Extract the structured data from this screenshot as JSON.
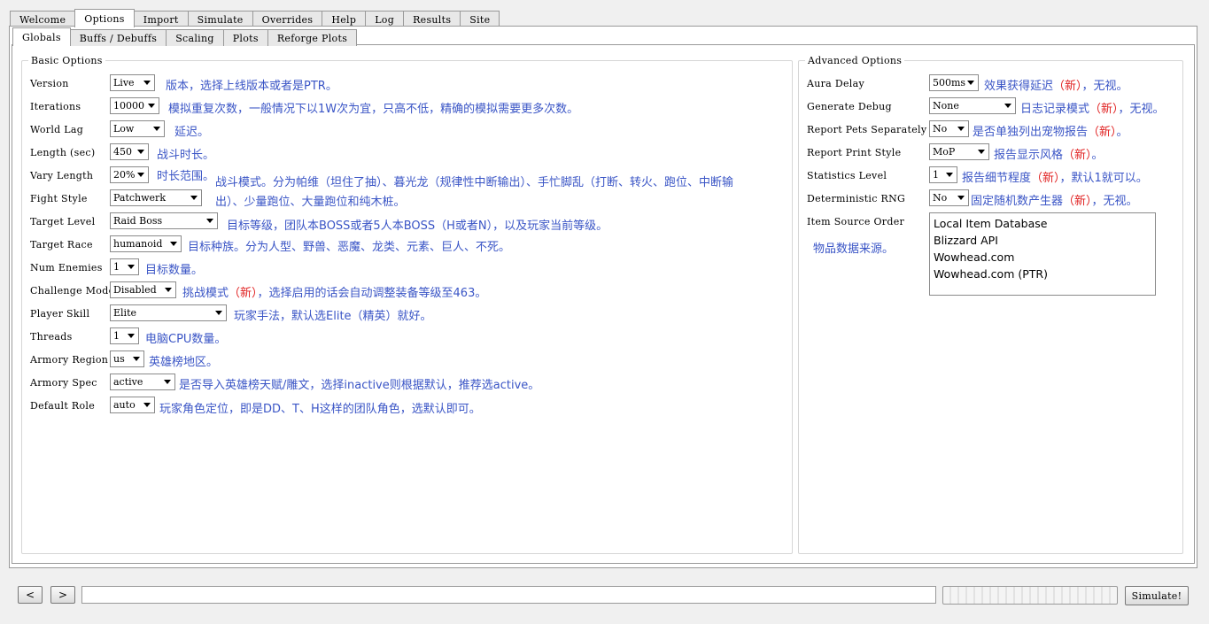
{
  "main_tabs": [
    "Welcome",
    "Options",
    "Import",
    "Simulate",
    "Overrides",
    "Help",
    "Log",
    "Results",
    "Site"
  ],
  "sub_tabs": [
    "Globals",
    "Buffs / Debuffs",
    "Scaling",
    "Plots",
    "Reforge Plots"
  ],
  "basic": {
    "title": "Basic Options",
    "rows": [
      {
        "label": "Version",
        "value": "Live",
        "note": "版本，选择上线版本或者是PTR。"
      },
      {
        "label": "Iterations",
        "value": "10000",
        "note": "模拟重复次数，一般情况下以1W次为宜，只高不低，精确的模拟需要更多次数。"
      },
      {
        "label": "World Lag",
        "value": "Low",
        "note": "延迟。"
      },
      {
        "label": "Length (sec)",
        "value": "450",
        "note": "战斗时长。"
      },
      {
        "label": "Vary Length",
        "value": "20%",
        "note": "时长范围。"
      },
      {
        "label": "Fight Style",
        "value": "Patchwerk",
        "note": "战斗模式。分为帕维（坦住了抽）、暮光龙（规律性中断输出）、手忙脚乱（打断、转火、跑位、中断输出）、少量跑位、大量跑位和纯木桩。"
      },
      {
        "label": "Target Level",
        "value": "Raid Boss",
        "note": "目标等级，团队本BOSS或者5人本BOSS（H或者N），以及玩家当前等级。"
      },
      {
        "label": "Target Race",
        "value": "humanoid",
        "note": "目标种族。分为人型、野兽、恶魔、龙类、元素、巨人、不死。"
      },
      {
        "label": "Num Enemies",
        "value": "1",
        "note": "目标数量。"
      },
      {
        "label": "Challenge Mode",
        "value": "Disabled",
        "note_pre": "挑战模式",
        "note_new": "（新）",
        "note_post": "，选择启用的话会自动调整装备等级至463。"
      },
      {
        "label": "Player Skill",
        "value": "Elite",
        "note": "玩家手法，默认选Elite（精英）就好。"
      },
      {
        "label": "Threads",
        "value": "1",
        "note": "电脑CPU数量。"
      },
      {
        "label": "Armory Region",
        "value": "us",
        "note": "英雄榜地区。"
      },
      {
        "label": "Armory Spec",
        "value": "active",
        "note": "是否导入英雄榜天赋/雕文，选择inactive则根据默认，推荐选active。"
      },
      {
        "label": "Default Role",
        "value": "auto",
        "note": "玩家角色定位，即是DD、T、H这样的团队角色，选默认即可。"
      }
    ]
  },
  "advanced": {
    "title": "Advanced Options",
    "rows": [
      {
        "label": "Aura Delay",
        "value": "500ms",
        "note_pre": "效果获得延迟",
        "note_new": "（新）",
        "note_post": "，无视。"
      },
      {
        "label": "Generate Debug",
        "value": "None",
        "note_pre": "日志记录模式",
        "note_new": "（新）",
        "note_post": "，无视。"
      },
      {
        "label": "Report Pets Separately",
        "value": "No",
        "note_pre": "是否单独列出宠物报告",
        "note_new": "（新）",
        "note_post": "。"
      },
      {
        "label": "Report Print Style",
        "value": "MoP",
        "note_pre": "报告显示风格",
        "note_new": "（新）",
        "note_post": "。"
      },
      {
        "label": "Statistics Level",
        "value": "1",
        "note_pre": "报告细节程度",
        "note_new": "（新）",
        "note_post": "，默认1就可以。"
      },
      {
        "label": "Deterministic RNG",
        "value": "No",
        "note_pre": "固定随机数产生器",
        "note_new": "（新）",
        "note_post": "，无视。"
      }
    ],
    "item_source_label": "Item Source Order",
    "item_source_note": "物品数据来源。",
    "item_sources": [
      "Local Item Database",
      "Blizzard API",
      "Wowhead.com",
      "Wowhead.com (PTR)"
    ]
  },
  "bottom": {
    "back_icon": "<",
    "forward_icon": ">",
    "simulate_label": "Simulate!"
  }
}
